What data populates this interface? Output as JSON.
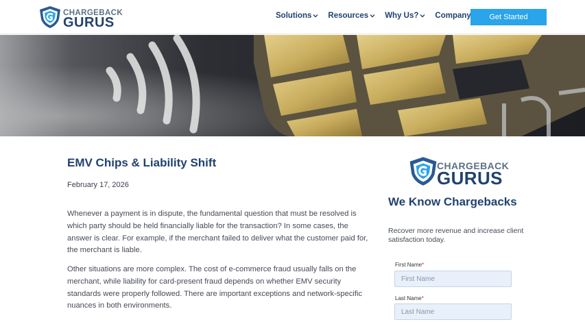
{
  "header": {
    "logo_top": "CHARGEBACK",
    "logo_bottom": "GURUS",
    "nav": [
      "Solutions",
      "Resources",
      "Why Us?",
      "Company"
    ],
    "cta_label": "Get Started"
  },
  "article": {
    "title": "EMV Chips & Liability Shift",
    "date": "February 17, 2026",
    "paragraphs": [
      "Whenever a payment is in dispute, the fundamental question that must be resolved is which party should be held financially liable for the transaction? In some cases, the answer is clear. For example, if the merchant failed to deliver what the customer paid for, the merchant is liable.",
      "Other situations are more complex. The cost of e-commerce fraud usually falls on the merchant, while liability for card-present fraud depends on whether EMV security standards were properly followed. There are important exceptions and network-specific nuances in both environments."
    ]
  },
  "sidebar": {
    "logo_top": "CHARGEBACK",
    "logo_bottom": "GURUS",
    "heading": "We Know Chargebacks",
    "subheading": "Recover more revenue and increase client satisfaction today.",
    "first_name_label": "First Name",
    "first_name_placeholder": "First Name",
    "last_name_label": "Last Name",
    "last_name_placeholder": "Last Name",
    "required_marker": "*"
  },
  "colors": {
    "brand_navy": "#21426f",
    "accent_blue": "#2aa4ea",
    "field_bg": "#e8f0fb"
  },
  "icons": [
    "shield-logo-icon",
    "chevron-down-icon",
    "contactless-icon"
  ]
}
